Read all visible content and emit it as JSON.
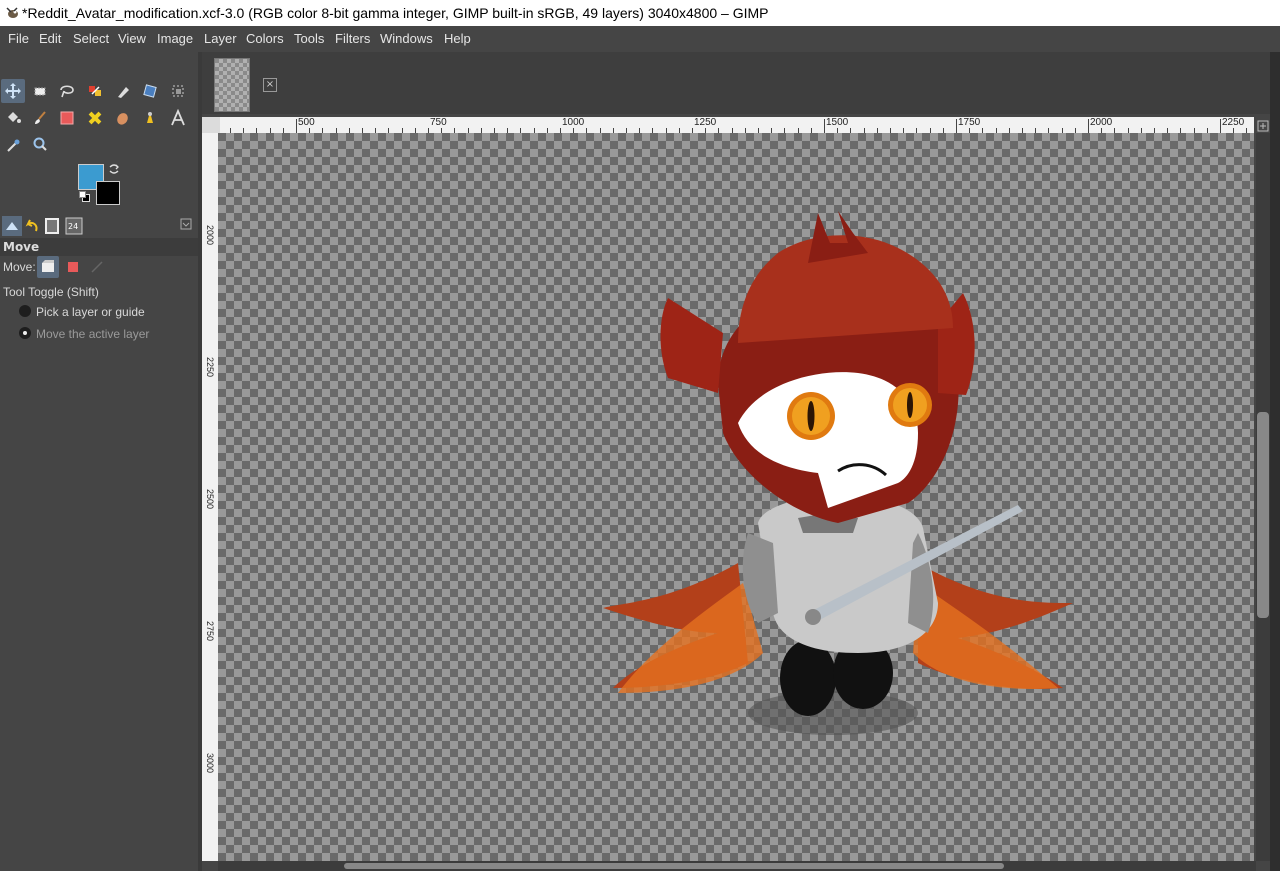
{
  "window": {
    "title": "*Reddit_Avatar_modification.xcf-3.0 (RGB color 8-bit gamma integer, GIMP built-in sRGB, 49 layers) 3040x4800 – GIMP"
  },
  "menu": [
    "File",
    "Edit",
    "Select",
    "View",
    "Image",
    "Layer",
    "Colors",
    "Tools",
    "Filters",
    "Windows",
    "Help"
  ],
  "toolbox": {
    "tools": [
      "move-tool",
      "rect-select-tool",
      "free-select-tool",
      "fuzzy-select-tool",
      "paths-tool",
      "transform-tool",
      "crop-tool",
      "bucket-fill-tool",
      "paintbrush-tool",
      "eraser-tool",
      "healing-tool",
      "smudge-tool",
      "dodge-tool",
      "text-tool",
      "color-picker-tool",
      "zoom-tool"
    ],
    "colors": {
      "foreground": "#3b9bd0",
      "background": "#000000"
    }
  },
  "tool_options": {
    "header": "Move",
    "move_label": "Move:",
    "toggle_label": "Tool Toggle  (Shift)",
    "options": [
      "Pick a layer or guide",
      "Move the active layer"
    ],
    "selected_option": 1
  },
  "rulers": {
    "horizontal": [
      "500",
      "750",
      "1000",
      "1250",
      "1500",
      "1750",
      "2000",
      "2250"
    ],
    "vertical": [
      "2000",
      "2250",
      "2500",
      "2750",
      "3000"
    ]
  },
  "canvas": {
    "checker_dark": "#6a6a6a",
    "checker_light": "#999999"
  }
}
